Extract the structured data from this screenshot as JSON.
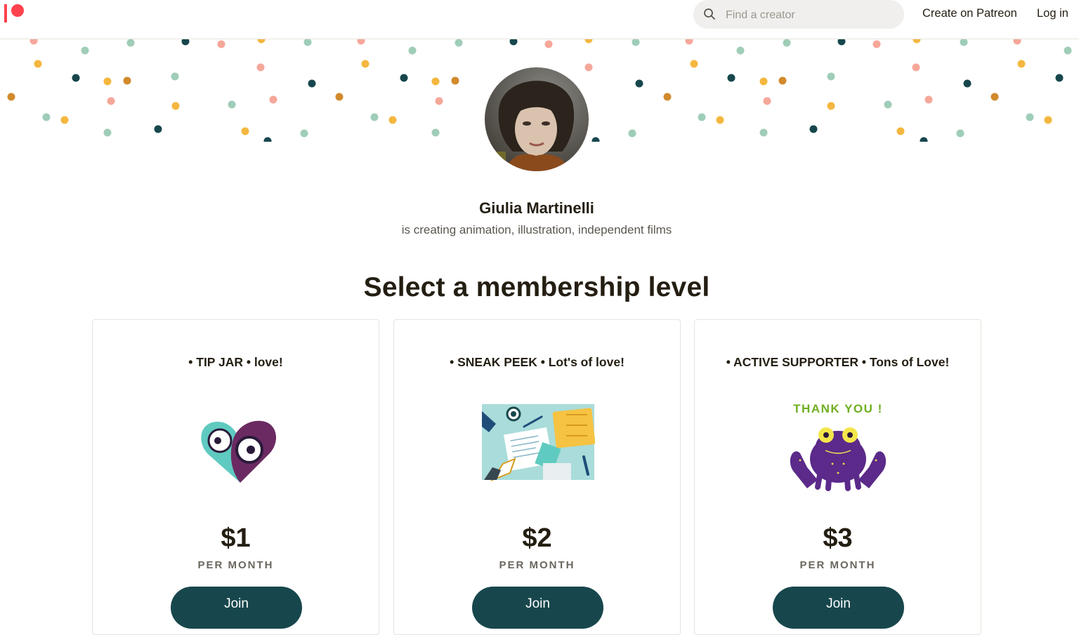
{
  "header": {
    "search_placeholder": "Find a creator",
    "create_label": "Create on Patreon",
    "login_label": "Log in"
  },
  "creator": {
    "name": "Giulia Martinelli",
    "tagline": "is creating animation, illustration, independent films"
  },
  "membership": {
    "title": "Select a membership level",
    "tiers": [
      {
        "name": "• TIP JAR • love!",
        "price": "$1",
        "period": "PER MONTH",
        "join_label": "Join",
        "image": "heart-eyes-illustration"
      },
      {
        "name": "• SNEAK PEEK • Lot's of love!",
        "price": "$2",
        "period": "PER MONTH",
        "join_label": "Join",
        "image": "desk-sketch-illustration"
      },
      {
        "name": "• ACTIVE SUPPORTER • Tons of Love!",
        "price": "$3",
        "period": "PER MONTH",
        "join_label": "Join",
        "image": "thank-you-frog-illustration"
      }
    ],
    "frog_caption": "THANK YOU !"
  },
  "colors": {
    "brand": "#ff424d",
    "button": "#17474d",
    "dot_colors": [
      "#17474d",
      "#f4b73f",
      "#f6a79a",
      "#9fcdb8",
      "#d18a2c"
    ]
  },
  "icons": {
    "search": "search-icon",
    "logo": "patreon-logo"
  }
}
